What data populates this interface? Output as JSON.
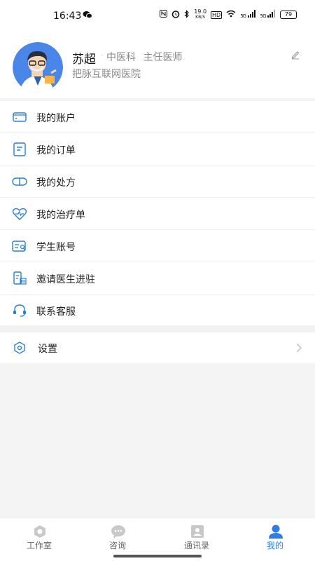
{
  "status_bar": {
    "time": "16:43",
    "net_speed_value": "19.0",
    "net_speed_unit": "KB/S",
    "hd": "HD",
    "signal_1": "5G",
    "signal_2": "5G",
    "battery": "79"
  },
  "profile": {
    "name": "苏超",
    "department": "中医科",
    "title": "主任医师",
    "hospital": "把脉互联网医院"
  },
  "menu": [
    {
      "label": "我的账户",
      "icon": "wallet-icon"
    },
    {
      "label": "我的订单",
      "icon": "order-icon"
    },
    {
      "label": "我的处方",
      "icon": "pill-icon"
    },
    {
      "label": "我的治疗单",
      "icon": "heart-icon"
    },
    {
      "label": "学生账号",
      "icon": "student-id-icon"
    },
    {
      "label": "邀请医生进驻",
      "icon": "invite-doctor-icon"
    },
    {
      "label": "联系客服",
      "icon": "headset-icon"
    }
  ],
  "settings": {
    "label": "设置",
    "icon": "settings-hexagon-icon"
  },
  "tabbar": [
    {
      "label": "工作室",
      "icon": "workroom-icon",
      "active": false
    },
    {
      "label": "咨询",
      "icon": "chat-icon",
      "active": false
    },
    {
      "label": "通讯录",
      "icon": "contacts-icon",
      "active": false
    },
    {
      "label": "我的",
      "icon": "person-icon",
      "active": true
    }
  ],
  "colors": {
    "accent": "#2f7de1",
    "icon_blue": "#2b7fd0",
    "inactive": "#c8c8c8"
  }
}
